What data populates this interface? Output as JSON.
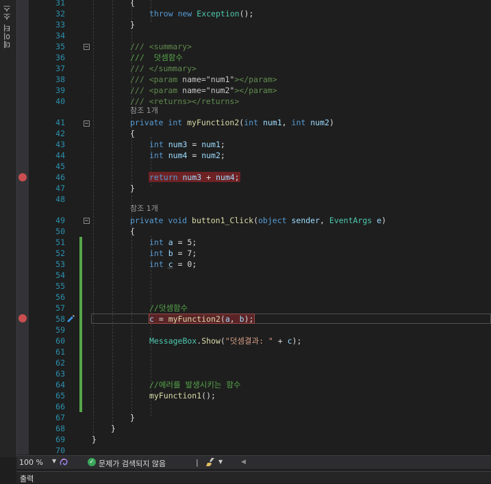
{
  "sidebar": {
    "label": "데이터 소스"
  },
  "lines": [
    {
      "n": "31",
      "t": "{"
    },
    {
      "n": "32",
      "t": "throw new Exception();"
    },
    {
      "n": "33",
      "t": "}"
    },
    {
      "n": "34",
      "t": ""
    },
    {
      "n": "35",
      "t": "/// <summary>"
    },
    {
      "n": "36",
      "t": "///  덧셈함수"
    },
    {
      "n": "37",
      "t": "/// </summary>"
    },
    {
      "n": "38",
      "t": "/// <param name=\"num1\"></param>"
    },
    {
      "n": "39",
      "t": "/// <param name=\"num2\"></param>"
    },
    {
      "n": "40",
      "t": "/// <returns></returns>"
    },
    {
      "n": "41",
      "t": "private int myFunction2(int num1, int num2)"
    },
    {
      "n": "42",
      "t": "{"
    },
    {
      "n": "43",
      "t": "int num3 = num1;"
    },
    {
      "n": "44",
      "t": "int num4 = num2;"
    },
    {
      "n": "45",
      "t": ""
    },
    {
      "n": "46",
      "t": "return num3 + num4;"
    },
    {
      "n": "47",
      "t": "}"
    },
    {
      "n": "48",
      "t": ""
    },
    {
      "n": "49",
      "t": "private void button1_Click(object sender, EventArgs e)"
    },
    {
      "n": "50",
      "t": "{"
    },
    {
      "n": "51",
      "t": "int a = 5;"
    },
    {
      "n": "52",
      "t": "int b = 7;"
    },
    {
      "n": "53",
      "t": "int c = 0;"
    },
    {
      "n": "54",
      "t": ""
    },
    {
      "n": "55",
      "t": ""
    },
    {
      "n": "56",
      "t": ""
    },
    {
      "n": "57",
      "t": "//덧셈함수"
    },
    {
      "n": "58",
      "t": "c = myFunction2(a, b);"
    },
    {
      "n": "59",
      "t": ""
    },
    {
      "n": "60",
      "t": "MessageBox.Show(\"덧셈결과: \" + c);"
    },
    {
      "n": "61",
      "t": ""
    },
    {
      "n": "62",
      "t": ""
    },
    {
      "n": "63",
      "t": ""
    },
    {
      "n": "64",
      "t": "//에러를 발생시키는 함수"
    },
    {
      "n": "65",
      "t": "myFunction1();"
    },
    {
      "n": "66",
      "t": ""
    },
    {
      "n": "67",
      "t": "}"
    },
    {
      "n": "68",
      "t": "}"
    },
    {
      "n": "69",
      "t": "}"
    },
    {
      "n": "70",
      "t": ""
    }
  ],
  "ref_labels": {
    "ref1": "참조 1개",
    "ref2": "참조 1개"
  },
  "status": {
    "zoom": "100 %",
    "message": "문제가 검색되지 않음",
    "separator": "|"
  },
  "output_tab": {
    "label": "출력"
  },
  "icons": {
    "ok": "check-circle-icon",
    "ai": "ai-assistant-icon",
    "brush": "cleanup-brush-icon",
    "pen": "edit-pencil-icon"
  },
  "colors": {
    "breakpoint": "#c94e50",
    "change_bar": "#57a64a",
    "keyword": "#569cd6",
    "comment": "#57a64a",
    "line_number": "#2b91af"
  }
}
